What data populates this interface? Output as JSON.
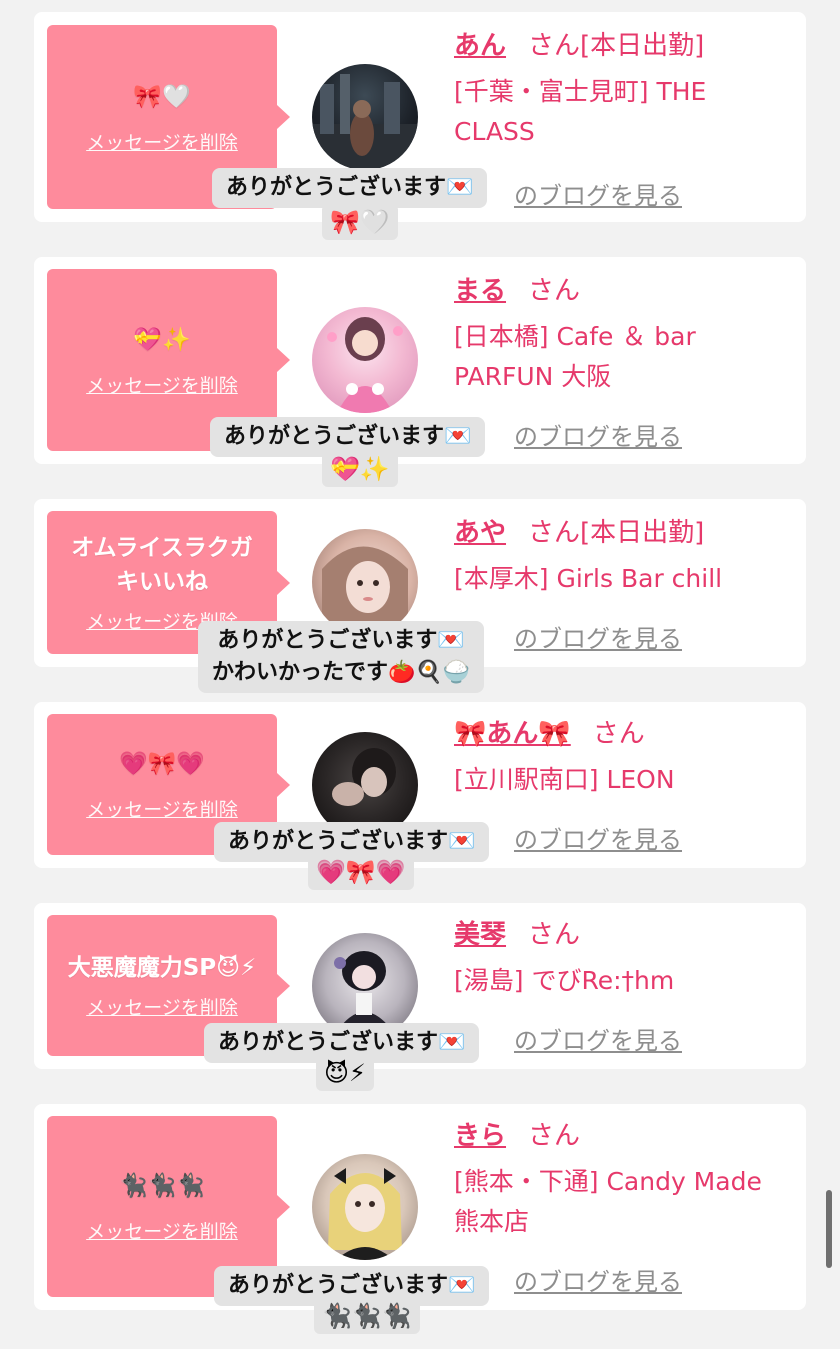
{
  "delete_label": "メッセージを削除",
  "blog_label": "のブログを見る",
  "san_label": "さん",
  "colors": {
    "accent": "#e6396b",
    "bubble": "#fe8b9c",
    "tooltip_bg": "#e3e3e3",
    "page_bg": "#f2f2f2"
  },
  "cards": [
    {
      "message": "🎀🤍",
      "name": "あん",
      "status": "[本日出勤]",
      "shop": "[千葉・富士見町] THE CLASS",
      "tooltip_line1": "ありがとうございます💌",
      "tooltip_line2": "🎀🤍"
    },
    {
      "message": "💝✨",
      "name": "まる",
      "status": "",
      "shop": "[日本橋] Cafe ＆ bar PARFUN 大阪",
      "tooltip_line1": "ありがとうございます💌",
      "tooltip_line2": "💝✨"
    },
    {
      "message": "オムライスラクガキいいね",
      "name": "あや",
      "status": "[本日出勤]",
      "shop": "[本厚木] Girls Bar chill",
      "tooltip_line1": "ありがとうございます💌",
      "tooltip_line2": "かわいかったです🍅🍳🍚"
    },
    {
      "message": "💗🎀💗",
      "name": "🎀あん🎀",
      "status": "",
      "shop": "[立川駅南口] LEON",
      "tooltip_line1": "ありがとうございます💌",
      "tooltip_line2": "💗🎀💗"
    },
    {
      "message": "大悪魔魔力SP😈⚡",
      "name": "美琴",
      "status": "",
      "shop": "[湯島] でびRe:†hm",
      "tooltip_line1": "ありがとうございます💌",
      "tooltip_line2": "😈⚡"
    },
    {
      "message": "🐈‍⬛🐈‍⬛🐈‍⬛",
      "name": "きら",
      "status": "",
      "shop": "[熊本・下通] Candy Made 熊本店",
      "tooltip_line1": "ありがとうございます💌",
      "tooltip_line2": "🐈‍⬛🐈‍⬛🐈‍⬛"
    }
  ]
}
